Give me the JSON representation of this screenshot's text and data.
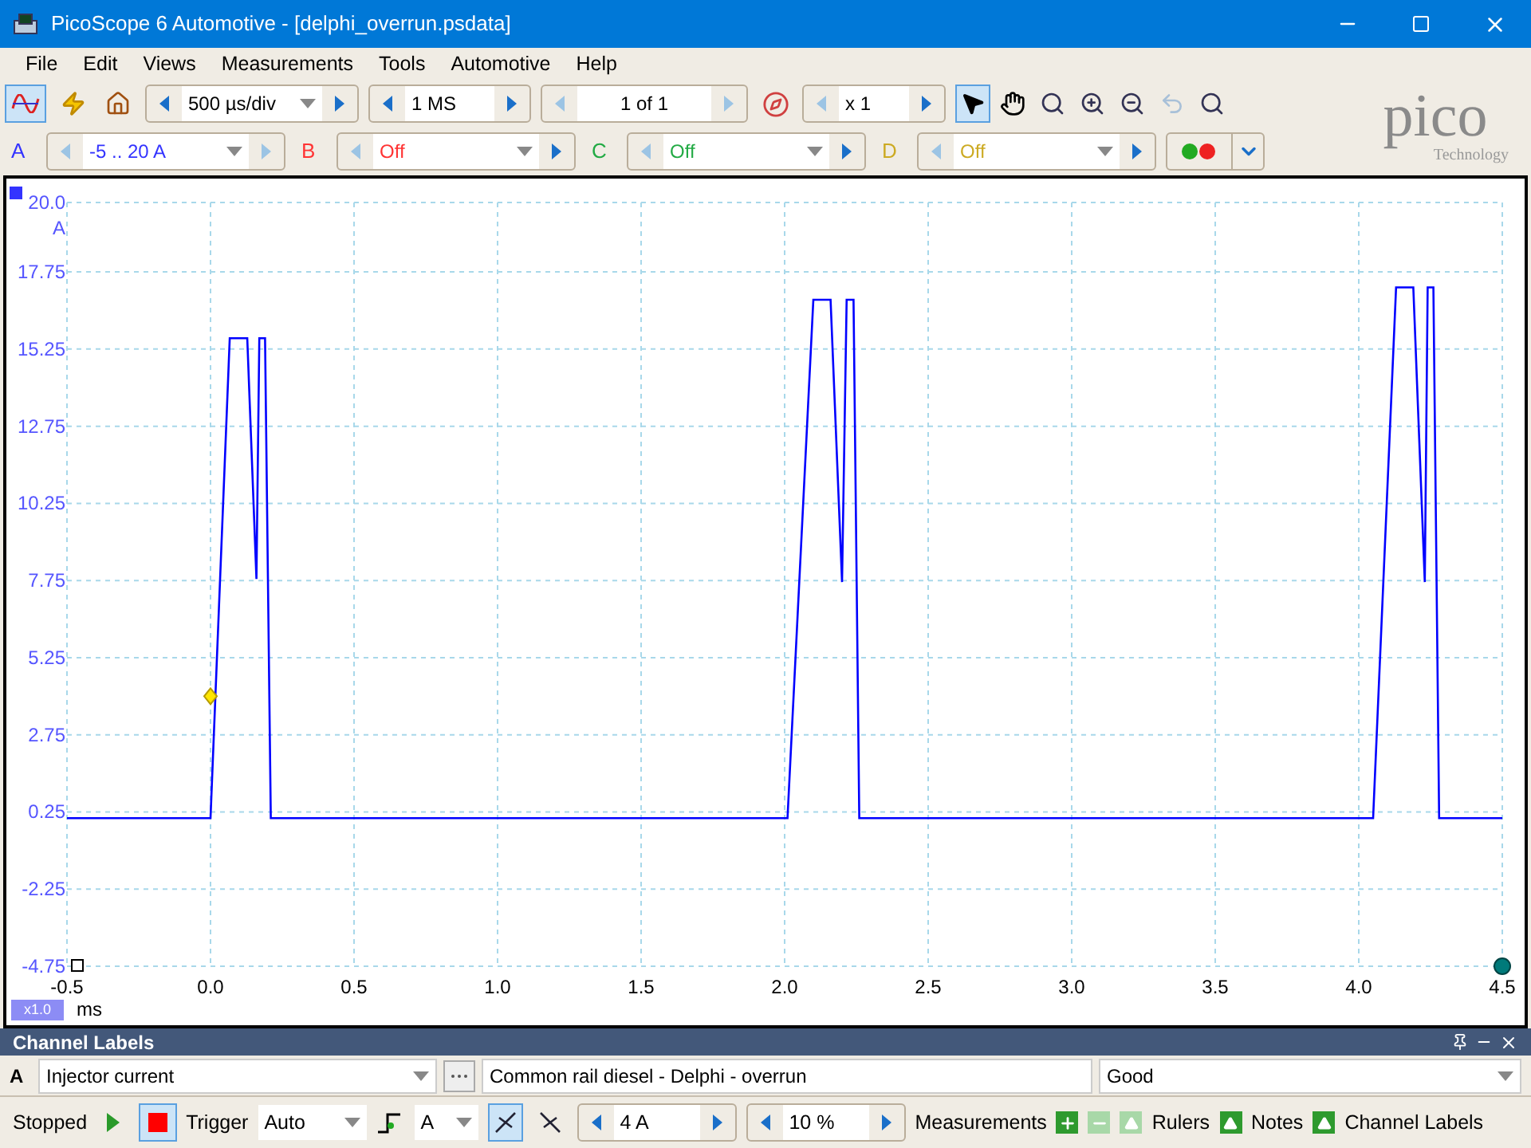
{
  "window": {
    "title": "PicoScope 6 Automotive - [delphi_overrun.psdata]"
  },
  "menu": [
    {
      "label": "File"
    },
    {
      "label": "Edit"
    },
    {
      "label": "Views"
    },
    {
      "label": "Measurements"
    },
    {
      "label": "Tools"
    },
    {
      "label": "Automotive"
    },
    {
      "label": "Help"
    }
  ],
  "toolbar": {
    "scope_mode_selected": true,
    "timebase": "500 µs/div",
    "samples": "1 MS",
    "buffer": "1 of 1",
    "zoom": "x 1",
    "tools": [
      {
        "kind": "pointer",
        "selected": true
      },
      {
        "kind": "hand",
        "selected": false
      },
      {
        "kind": "zoom",
        "selected": false
      },
      {
        "kind": "zoom-in",
        "selected": false
      },
      {
        "kind": "zoom-out",
        "selected": false
      },
      {
        "kind": "undo",
        "selected": false,
        "disabled": true
      },
      {
        "kind": "zoom-fit",
        "selected": false
      }
    ]
  },
  "logo": {
    "name": "pico",
    "tagline": "Technology"
  },
  "channels": [
    {
      "name": "A",
      "range": "-5 .. 20 A",
      "color": "#3333ff"
    },
    {
      "name": "B",
      "range": "Off",
      "color": "#ff3333"
    },
    {
      "name": "C",
      "range": "Off",
      "color": "#22aa44"
    },
    {
      "name": "D",
      "range": "Off",
      "color": "#ccaa22"
    }
  ],
  "scope": {
    "y_unit": "A",
    "x_unit": "ms",
    "x_scale": "x1.0",
    "chart_data": {
      "type": "line",
      "xlim": [
        -0.5,
        4.5
      ],
      "ylim": [
        -4.75,
        20
      ],
      "xticks": [
        {
          "value": -0.5,
          "label": "-0.5"
        },
        {
          "value": 0,
          "label": "0.0"
        },
        {
          "value": 0.5,
          "label": "0.5"
        },
        {
          "value": 1,
          "label": "1.0"
        },
        {
          "value": 1.5,
          "label": "1.5"
        },
        {
          "value": 2,
          "label": "2.0"
        },
        {
          "value": 2.5,
          "label": "2.5"
        },
        {
          "value": 3,
          "label": "3.0"
        },
        {
          "value": 3.5,
          "label": "3.5"
        },
        {
          "value": 4,
          "label": "4.0"
        },
        {
          "value": 4.5,
          "label": "4.5"
        }
      ],
      "grid": true,
      "yticks": [
        {
          "value": 20,
          "label": "20.0"
        },
        17.75,
        15.25,
        12.75,
        10.25,
        7.75,
        5.25,
        2.75,
        0.25,
        -2.25,
        -4.75
      ],
      "x": [
        -0.5,
        0.0,
        0.067,
        0.128,
        0.16,
        0.17,
        0.19,
        0.21,
        2.01,
        2.1,
        2.16,
        2.2,
        2.216,
        2.24,
        2.26,
        4.05,
        4.13,
        4.19,
        4.23,
        4.24,
        4.26,
        4.28,
        4.5
      ],
      "series": [
        {
          "color": "#0000ff",
          "values": [
            0.05,
            0.05,
            15.6,
            15.6,
            7.8,
            15.6,
            15.6,
            0.05,
            0.05,
            16.85,
            16.85,
            7.7,
            16.85,
            16.85,
            0.05,
            0.05,
            17.25,
            17.25,
            7.7,
            17.25,
            17.25,
            0.05,
            0.05
          ]
        }
      ]
    }
  },
  "channel_labels": {
    "title": "Channel Labels",
    "channel": "A",
    "label": "Injector current",
    "description": "Common rail diesel - Delphi - overrun",
    "quality": "Good"
  },
  "status_bar": {
    "state": "Stopped",
    "running": false,
    "trigger_label": "Trigger",
    "trigger_mode": "Auto",
    "trigger_channel": "A",
    "rising_edge": true,
    "threshold": "4 A",
    "pretrigger": "10 %",
    "measurements": "Measurements",
    "rulers": "Rulers",
    "notes": "Notes",
    "channel_labels": "Channel Labels"
  }
}
